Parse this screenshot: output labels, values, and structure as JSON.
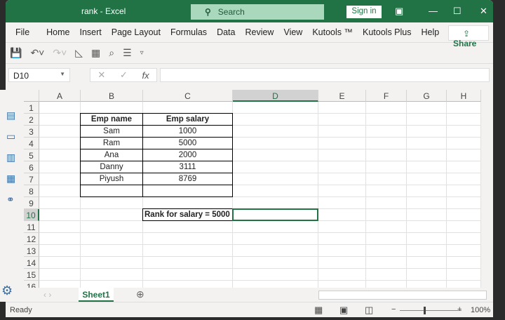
{
  "title": {
    "doc": "rank  -  Excel",
    "search": "Search",
    "sign_in": "Sign in"
  },
  "menu": [
    "File",
    "Home",
    "Insert",
    "Page Layout",
    "Formulas",
    "Data",
    "Review",
    "View",
    "Kutools ™",
    "Kutools Plus",
    "Help"
  ],
  "share": "Share",
  "formula_bar": {
    "name_box": "D10",
    "fx": "fx",
    "formula": ""
  },
  "columns": [
    "A",
    "B",
    "C",
    "D",
    "E",
    "F",
    "G",
    "H"
  ],
  "rows": [
    "1",
    "2",
    "3",
    "4",
    "5",
    "6",
    "7",
    "8",
    "9",
    "10",
    "11",
    "12",
    "13",
    "14",
    "15",
    "16"
  ],
  "table": {
    "headers": [
      "Emp name",
      "Emp salary"
    ],
    "rows": [
      [
        "Sam",
        "1000"
      ],
      [
        "Ram",
        "5000"
      ],
      [
        "Ana",
        "2000"
      ],
      [
        "Danny",
        "3111"
      ],
      [
        "Piyush",
        "8769"
      ],
      [
        "",
        ""
      ]
    ]
  },
  "rank_label": "Rank for salary = 5000",
  "selected_cell": "D10",
  "sheet_tab": "Sheet1",
  "status": {
    "text": "Ready",
    "zoom": "100%"
  },
  "accent": "#217346"
}
